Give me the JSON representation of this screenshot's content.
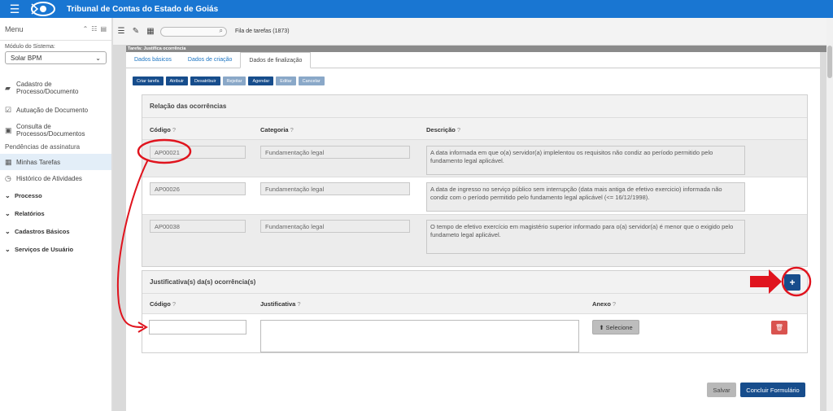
{
  "app": {
    "title": "Tribunal de Contas do Estado de Goiás"
  },
  "sidebar": {
    "menu_label": "Menu",
    "modulo_label": "Módulo do Sistema:",
    "modulo_value": "Solar BPM",
    "items": [
      {
        "label_1": "Cadastro de",
        "label_2": "Processo/Documento",
        "icon": "folder-plus-icon"
      },
      {
        "label_1": "Autuação de Documento",
        "icon": "check-square-icon"
      },
      {
        "label_1": "Consulta de",
        "label_2": "Processos/Documentos",
        "icon": "clipboard-icon"
      }
    ],
    "section_label": "Pendências de assinatura",
    "minhas_tarefas": "Minhas Tarefas",
    "historico": "Histórico de Atividades",
    "groups": [
      "Processo",
      "Relatórios",
      "Cadastros Básicos",
      "Serviços de Usuário"
    ]
  },
  "toolbar": {
    "queue_label": "Fila de tarefas (1873)"
  },
  "task_banner": "Tarefa: Justifica ocorrência",
  "tabs": [
    "Dados básicos",
    "Dados de criação",
    "Dados de finalização"
  ],
  "actions": [
    "Criar tarefa",
    "Atribuir",
    "Desatribuir",
    "Rejeitar",
    "Agendar",
    "Editar",
    "Cancelar"
  ],
  "ocorrencias": {
    "title": "Relação das ocorrências",
    "col_codigo": "Código",
    "col_categoria": "Categoria",
    "col_descricao": "Descrição",
    "rows": [
      {
        "codigo": "AP00021",
        "categoria": "Fundamentação legal",
        "descricao": "A data informada em que o(a) servidor(a) implelentou os requisitos não condiz ao período permitido pelo fundamento legal aplicável."
      },
      {
        "codigo": "AP00026",
        "categoria": "Fundamentação legal",
        "descricao": "A data de ingresso no serviço público sem interrupção (data mais antiga de efetivo exercicio) informada não condiz com o período permitido pelo fundamento legal aplicável (<= 16/12/1998)."
      },
      {
        "codigo": "AP00038",
        "categoria": "Fundamentação legal",
        "descricao": "O tempo de efetivo exercício em magistério superior informado para o(a) servidor(a) é menor que o exigido pelo fundameto legal aplicável."
      }
    ]
  },
  "justificativas": {
    "title": "Justificativa(s) da(s) ocorrência(s)",
    "col_codigo": "Código",
    "col_justificativa": "Justificativa",
    "col_anexo": "Anexo",
    "add_label": "+",
    "selecione_label": "Selecione",
    "codigo_value": "",
    "justificativa_value": ""
  },
  "footer": {
    "salvar": "Salvar",
    "concluir": "Concluir Formulário"
  },
  "colors": {
    "topbar": "#1976d2",
    "primary_button": "#174d8c",
    "annotation": "#e0141e",
    "delete": "#d9534f"
  }
}
